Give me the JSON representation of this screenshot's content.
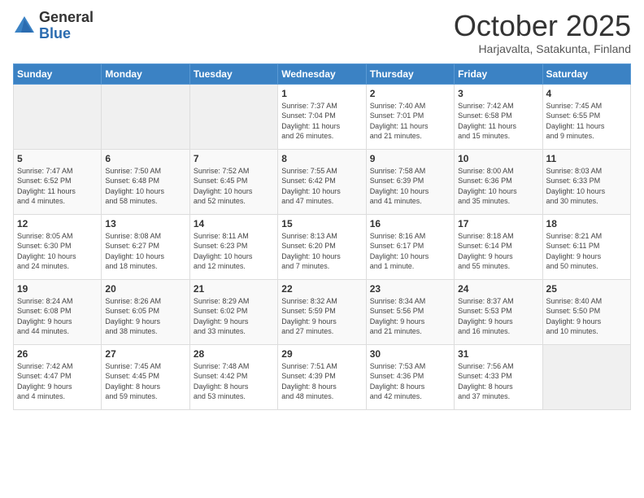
{
  "logo": {
    "general": "General",
    "blue": "Blue"
  },
  "header": {
    "month": "October 2025",
    "location": "Harjavalta, Satakunta, Finland"
  },
  "weekdays": [
    "Sunday",
    "Monday",
    "Tuesday",
    "Wednesday",
    "Thursday",
    "Friday",
    "Saturday"
  ],
  "weeks": [
    [
      {
        "day": "",
        "info": ""
      },
      {
        "day": "",
        "info": ""
      },
      {
        "day": "",
        "info": ""
      },
      {
        "day": "1",
        "info": "Sunrise: 7:37 AM\nSunset: 7:04 PM\nDaylight: 11 hours\nand 26 minutes."
      },
      {
        "day": "2",
        "info": "Sunrise: 7:40 AM\nSunset: 7:01 PM\nDaylight: 11 hours\nand 21 minutes."
      },
      {
        "day": "3",
        "info": "Sunrise: 7:42 AM\nSunset: 6:58 PM\nDaylight: 11 hours\nand 15 minutes."
      },
      {
        "day": "4",
        "info": "Sunrise: 7:45 AM\nSunset: 6:55 PM\nDaylight: 11 hours\nand 9 minutes."
      }
    ],
    [
      {
        "day": "5",
        "info": "Sunrise: 7:47 AM\nSunset: 6:52 PM\nDaylight: 11 hours\nand 4 minutes."
      },
      {
        "day": "6",
        "info": "Sunrise: 7:50 AM\nSunset: 6:48 PM\nDaylight: 10 hours\nand 58 minutes."
      },
      {
        "day": "7",
        "info": "Sunrise: 7:52 AM\nSunset: 6:45 PM\nDaylight: 10 hours\nand 52 minutes."
      },
      {
        "day": "8",
        "info": "Sunrise: 7:55 AM\nSunset: 6:42 PM\nDaylight: 10 hours\nand 47 minutes."
      },
      {
        "day": "9",
        "info": "Sunrise: 7:58 AM\nSunset: 6:39 PM\nDaylight: 10 hours\nand 41 minutes."
      },
      {
        "day": "10",
        "info": "Sunrise: 8:00 AM\nSunset: 6:36 PM\nDaylight: 10 hours\nand 35 minutes."
      },
      {
        "day": "11",
        "info": "Sunrise: 8:03 AM\nSunset: 6:33 PM\nDaylight: 10 hours\nand 30 minutes."
      }
    ],
    [
      {
        "day": "12",
        "info": "Sunrise: 8:05 AM\nSunset: 6:30 PM\nDaylight: 10 hours\nand 24 minutes."
      },
      {
        "day": "13",
        "info": "Sunrise: 8:08 AM\nSunset: 6:27 PM\nDaylight: 10 hours\nand 18 minutes."
      },
      {
        "day": "14",
        "info": "Sunrise: 8:11 AM\nSunset: 6:23 PM\nDaylight: 10 hours\nand 12 minutes."
      },
      {
        "day": "15",
        "info": "Sunrise: 8:13 AM\nSunset: 6:20 PM\nDaylight: 10 hours\nand 7 minutes."
      },
      {
        "day": "16",
        "info": "Sunrise: 8:16 AM\nSunset: 6:17 PM\nDaylight: 10 hours\nand 1 minute."
      },
      {
        "day": "17",
        "info": "Sunrise: 8:18 AM\nSunset: 6:14 PM\nDaylight: 9 hours\nand 55 minutes."
      },
      {
        "day": "18",
        "info": "Sunrise: 8:21 AM\nSunset: 6:11 PM\nDaylight: 9 hours\nand 50 minutes."
      }
    ],
    [
      {
        "day": "19",
        "info": "Sunrise: 8:24 AM\nSunset: 6:08 PM\nDaylight: 9 hours\nand 44 minutes."
      },
      {
        "day": "20",
        "info": "Sunrise: 8:26 AM\nSunset: 6:05 PM\nDaylight: 9 hours\nand 38 minutes."
      },
      {
        "day": "21",
        "info": "Sunrise: 8:29 AM\nSunset: 6:02 PM\nDaylight: 9 hours\nand 33 minutes."
      },
      {
        "day": "22",
        "info": "Sunrise: 8:32 AM\nSunset: 5:59 PM\nDaylight: 9 hours\nand 27 minutes."
      },
      {
        "day": "23",
        "info": "Sunrise: 8:34 AM\nSunset: 5:56 PM\nDaylight: 9 hours\nand 21 minutes."
      },
      {
        "day": "24",
        "info": "Sunrise: 8:37 AM\nSunset: 5:53 PM\nDaylight: 9 hours\nand 16 minutes."
      },
      {
        "day": "25",
        "info": "Sunrise: 8:40 AM\nSunset: 5:50 PM\nDaylight: 9 hours\nand 10 minutes."
      }
    ],
    [
      {
        "day": "26",
        "info": "Sunrise: 7:42 AM\nSunset: 4:47 PM\nDaylight: 9 hours\nand 4 minutes."
      },
      {
        "day": "27",
        "info": "Sunrise: 7:45 AM\nSunset: 4:45 PM\nDaylight: 8 hours\nand 59 minutes."
      },
      {
        "day": "28",
        "info": "Sunrise: 7:48 AM\nSunset: 4:42 PM\nDaylight: 8 hours\nand 53 minutes."
      },
      {
        "day": "29",
        "info": "Sunrise: 7:51 AM\nSunset: 4:39 PM\nDaylight: 8 hours\nand 48 minutes."
      },
      {
        "day": "30",
        "info": "Sunrise: 7:53 AM\nSunset: 4:36 PM\nDaylight: 8 hours\nand 42 minutes."
      },
      {
        "day": "31",
        "info": "Sunrise: 7:56 AM\nSunset: 4:33 PM\nDaylight: 8 hours\nand 37 minutes."
      },
      {
        "day": "",
        "info": ""
      }
    ]
  ]
}
